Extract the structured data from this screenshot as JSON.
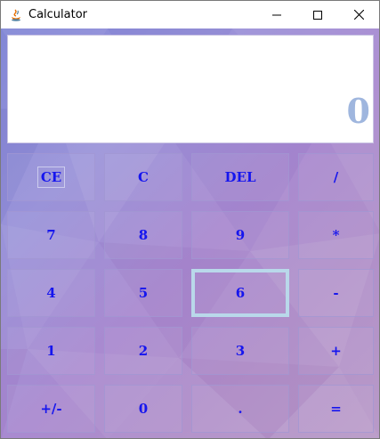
{
  "window": {
    "title": "Calculator",
    "controls": [
      "minimize",
      "maximize",
      "close"
    ]
  },
  "display": {
    "value": "0"
  },
  "keypad": {
    "rows": [
      [
        "CE",
        "C",
        "DEL",
        "/"
      ],
      [
        "7",
        "8",
        "9",
        "*"
      ],
      [
        "4",
        "5",
        "6",
        "-"
      ],
      [
        "1",
        "2",
        "3",
        "+"
      ],
      [
        "+/-",
        "0",
        ".",
        "="
      ]
    ]
  },
  "colors": {
    "key_text": "#1515ee",
    "display_text": "#9fb6de",
    "background_start": "#7f86d6",
    "background_end": "#b99ac8"
  }
}
